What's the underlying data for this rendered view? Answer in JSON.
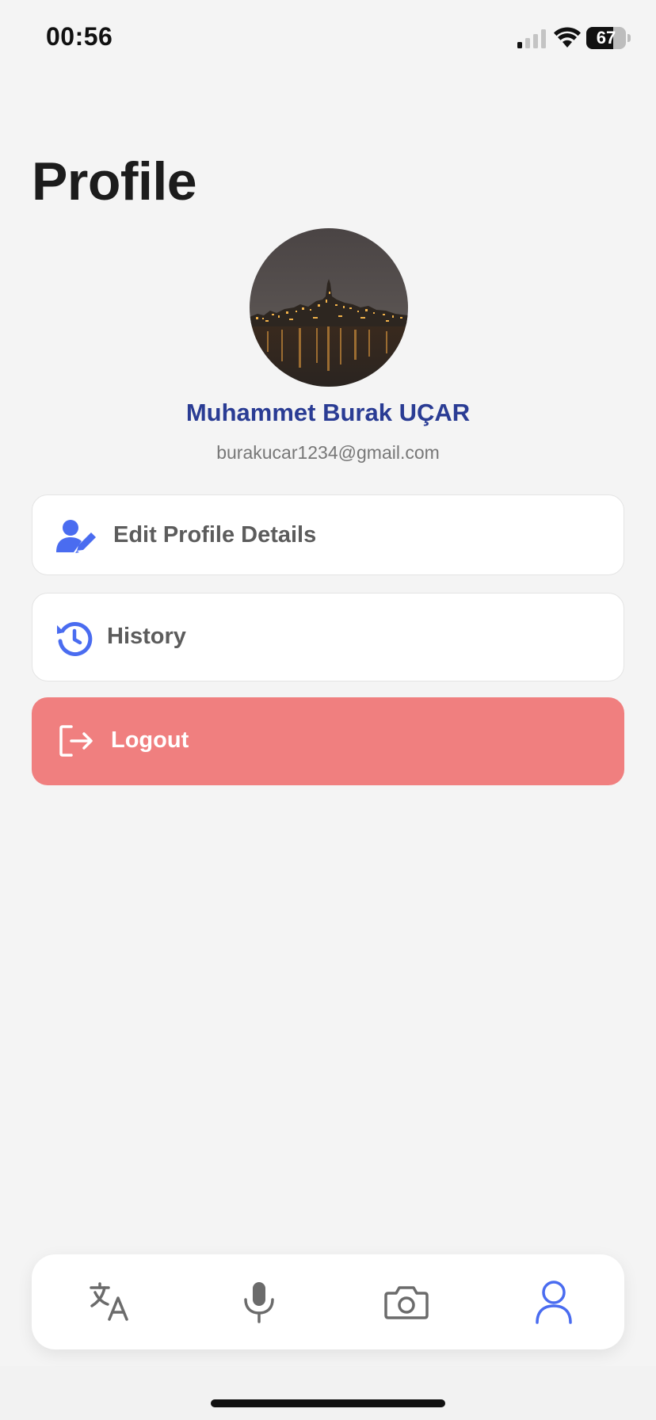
{
  "status_bar": {
    "time": "00:56",
    "battery_level": "67",
    "battery_fraction": 0.67
  },
  "page": {
    "title": "Profile"
  },
  "profile": {
    "name": "Muhammet Burak UÇAR",
    "email": "burakucar1234@gmail.com"
  },
  "menu": {
    "edit_profile_label": "Edit Profile Details",
    "history_label": "History",
    "logout_label": "Logout"
  },
  "bottom_nav": {
    "items": [
      "translate-icon",
      "microphone-icon",
      "camera-icon",
      "profile-icon"
    ],
    "active": "profile-icon"
  },
  "colors": {
    "accent": "#4a6cf0",
    "name": "#2a3c94",
    "logout_bg": "#f07f7f",
    "inactive_icon": "#6b6b6b"
  }
}
